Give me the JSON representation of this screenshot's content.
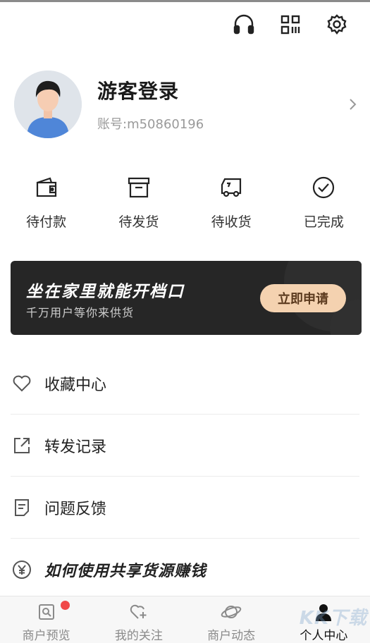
{
  "header": {
    "icons": [
      "headset-icon",
      "qrcode-icon",
      "gear-icon"
    ]
  },
  "profile": {
    "name": "游客登录",
    "account": "账号:m50860196"
  },
  "orders": [
    {
      "label": "待付款",
      "icon": "wallet-icon"
    },
    {
      "label": "待发货",
      "icon": "box-icon"
    },
    {
      "label": "待收货",
      "icon": "truck-icon"
    },
    {
      "label": "已完成",
      "icon": "check-circle-icon"
    }
  ],
  "banner": {
    "title": "坐在家里就能开档口",
    "subtitle": "千万用户等你来供货",
    "button": "立即申请"
  },
  "menu": [
    {
      "label": "收藏中心",
      "icon": "heart-icon"
    },
    {
      "label": "转发记录",
      "icon": "share-icon"
    },
    {
      "label": "问题反馈",
      "icon": "document-icon"
    },
    {
      "label": "如何使用共享货源赚钱",
      "icon": "yen-icon"
    }
  ],
  "tabbar": [
    {
      "label": "商户预览",
      "icon": "store-preview-icon",
      "badge": true
    },
    {
      "label": "我的关注",
      "icon": "heart-plus-icon"
    },
    {
      "label": "商户动态",
      "icon": "planet-icon"
    },
    {
      "label": "个人中心",
      "icon": "person-icon",
      "active": true
    }
  ],
  "colors": {
    "accent": "#f4d2b0",
    "badge": "#f04848",
    "banner_bg": "#262626"
  }
}
